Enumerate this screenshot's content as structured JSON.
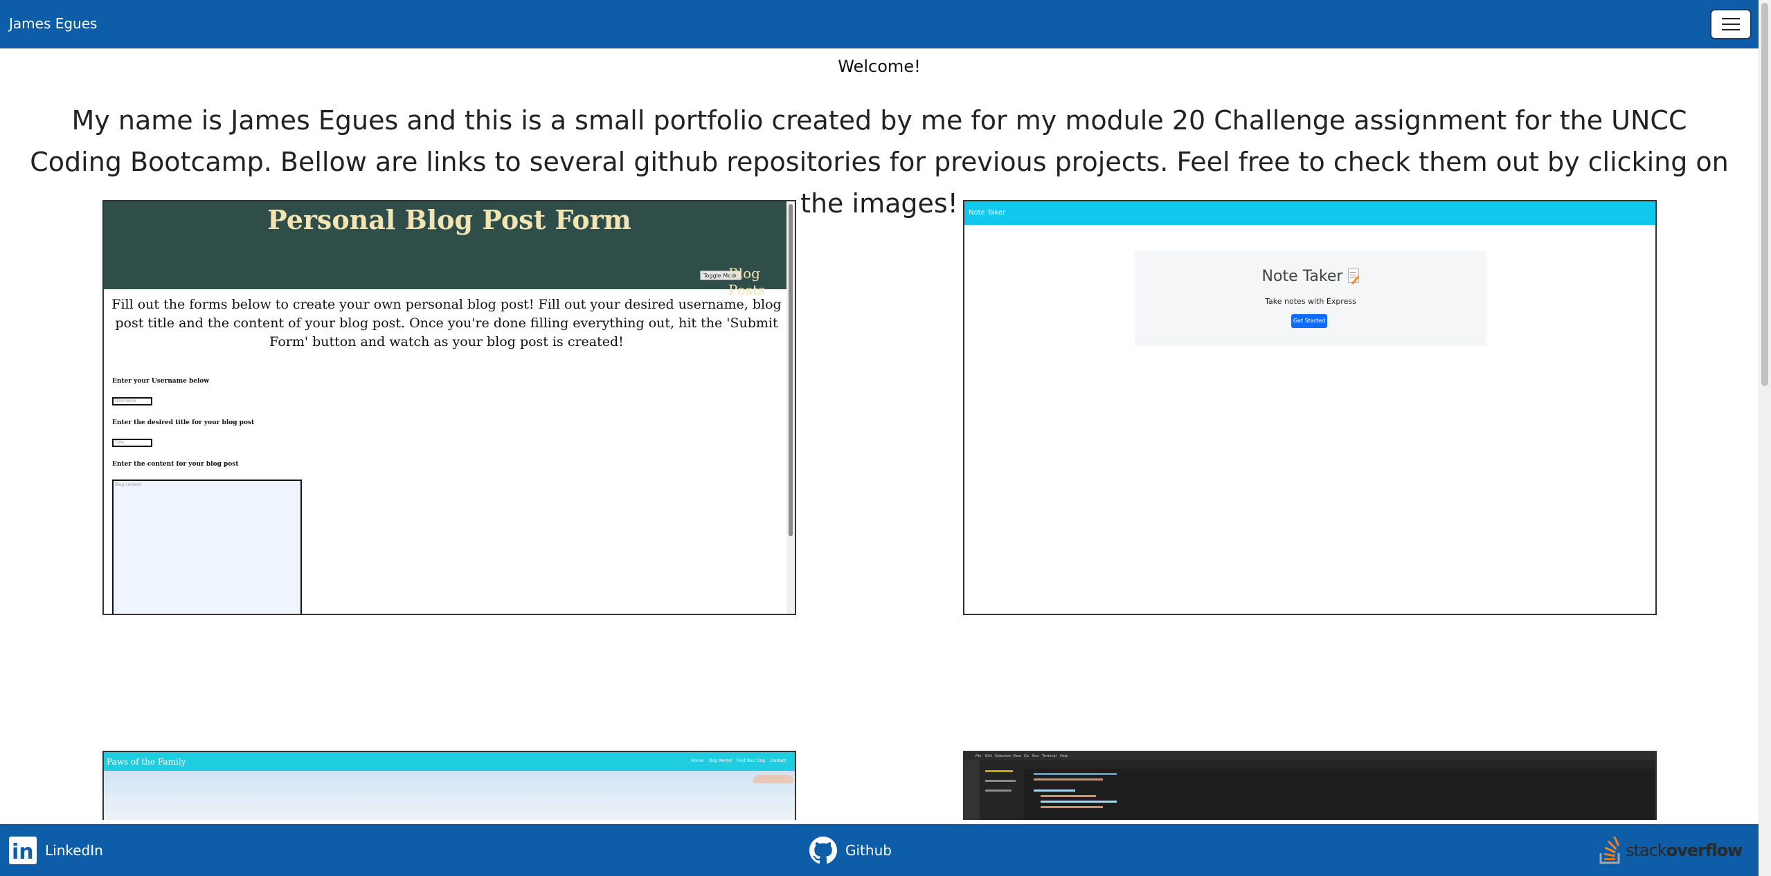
{
  "navbar": {
    "brand": "James Egues",
    "menu_icon": "hamburger-icon"
  },
  "welcome": "Welcome!",
  "intro": "My name is James Egues and this is a small portfolio created by me for my module 20 Challenge assignment for the UNCC Coding Bootcamp. Bellow are links to several github repositories for previous projects. Feel free to check them out by clicking on the images!",
  "projects": [
    {
      "title": "Personal Blog Post Form",
      "header_button": "Toggle Mode",
      "header_link": "Blog Posts",
      "description": "Fill out the forms below to create your own personal blog post! Fill out your desired username, blog post title and the content of your blog post. Once you're done filling everything out, hit the 'Submit Form' button and watch as your blog post is created!",
      "label_username": "Enter your Username below",
      "placeholder_username": "Username",
      "label_title": "Enter the desired title for your blog post",
      "placeholder_title": "Title",
      "label_content": "Enter the content for your blog post",
      "placeholder_content": "Blog content"
    },
    {
      "brand": "Note Taker",
      "heading": "Note Taker",
      "heading_icon": "memo-icon",
      "subtitle": "Take notes with Express",
      "button": "Get Started",
      "accent": "#10c8ee"
    },
    {
      "brand": "Paws of the Family",
      "nav": [
        "Home",
        "Dog Rental",
        "Find Your Dog",
        "Contact"
      ],
      "accent": "#1fcde0"
    },
    {
      "menu": [
        "File",
        "Edit",
        "Selection",
        "View",
        "Go",
        "Run",
        "Terminal",
        "Help"
      ]
    }
  ],
  "footer": {
    "linkedin_label": "LinkedIn",
    "linkedin_icon": "linkedin-icon",
    "github_label": "Github",
    "github_icon": "github-icon",
    "stackoverflow_pre": "stack",
    "stackoverflow_post": "overflow",
    "stackoverflow_icon": "stackoverflow-icon"
  },
  "colors": {
    "primary": "#0d5da8",
    "blog_header": "#2f4e4a",
    "blog_title": "#f3e4b4"
  }
}
